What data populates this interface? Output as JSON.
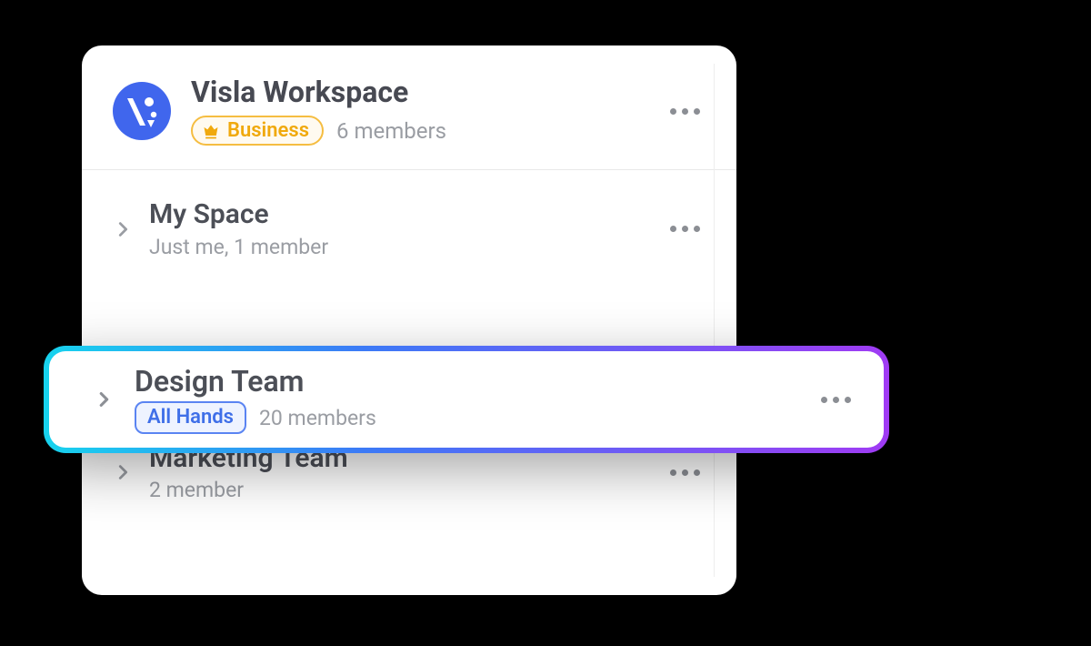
{
  "workspace": {
    "name": "Visla Workspace",
    "plan_label": "Business",
    "members_label": "6 members"
  },
  "spaces": [
    {
      "title": "My Space",
      "subtitle": "Just me, 1 member"
    },
    {
      "title": "Design Team",
      "tag": "All Hands",
      "members": "20 members",
      "highlighted": true
    },
    {
      "title": "Marketing Team",
      "subtitle": "2 member"
    }
  ]
}
